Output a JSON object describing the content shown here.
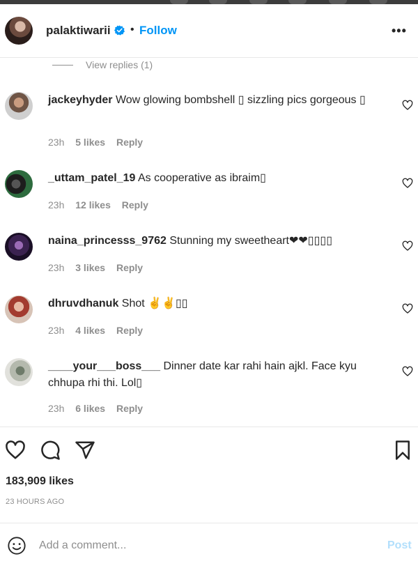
{
  "header": {
    "username": "palaktiwarii",
    "separator": "•",
    "follow_label": "Follow",
    "more_label": "•••",
    "verified_icon": "verified-badge-icon"
  },
  "view_replies": "View replies (1)",
  "comments": [
    {
      "username": "jackeyhyder",
      "text": "Wow glowing bombshell ▯ sizzling pics gorgeous ▯",
      "time": "23h",
      "likes": "5 likes",
      "reply": "Reply"
    },
    {
      "username": "_uttam_patel_19",
      "text": "As cooperative as ibraim▯",
      "time": "23h",
      "likes": "12 likes",
      "reply": "Reply"
    },
    {
      "username": "naina_princesss_9762",
      "text": "Stunning my sweetheart❤❤▯▯▯▯",
      "time": "23h",
      "likes": "3 likes",
      "reply": "Reply"
    },
    {
      "username": "dhruvdhanuk",
      "text": "Shot ✌✌▯▯",
      "time": "23h",
      "likes": "4 likes",
      "reply": "Reply"
    },
    {
      "username": "____your___boss___",
      "text": "Dinner date kar rahi hain ajkl. Face kyu chhupa rhi thi. Lol▯",
      "time": "23h",
      "likes": "6 likes",
      "reply": "Reply"
    }
  ],
  "post": {
    "likes": "183,909 likes",
    "time_ago": "23 HOURS AGO"
  },
  "add_comment": {
    "placeholder": "Add a comment...",
    "post_label": "Post"
  },
  "colors": {
    "accent": "#0095f6",
    "post_disabled": "#b2dffc",
    "muted": "#8e8e8e",
    "text": "#262626"
  }
}
